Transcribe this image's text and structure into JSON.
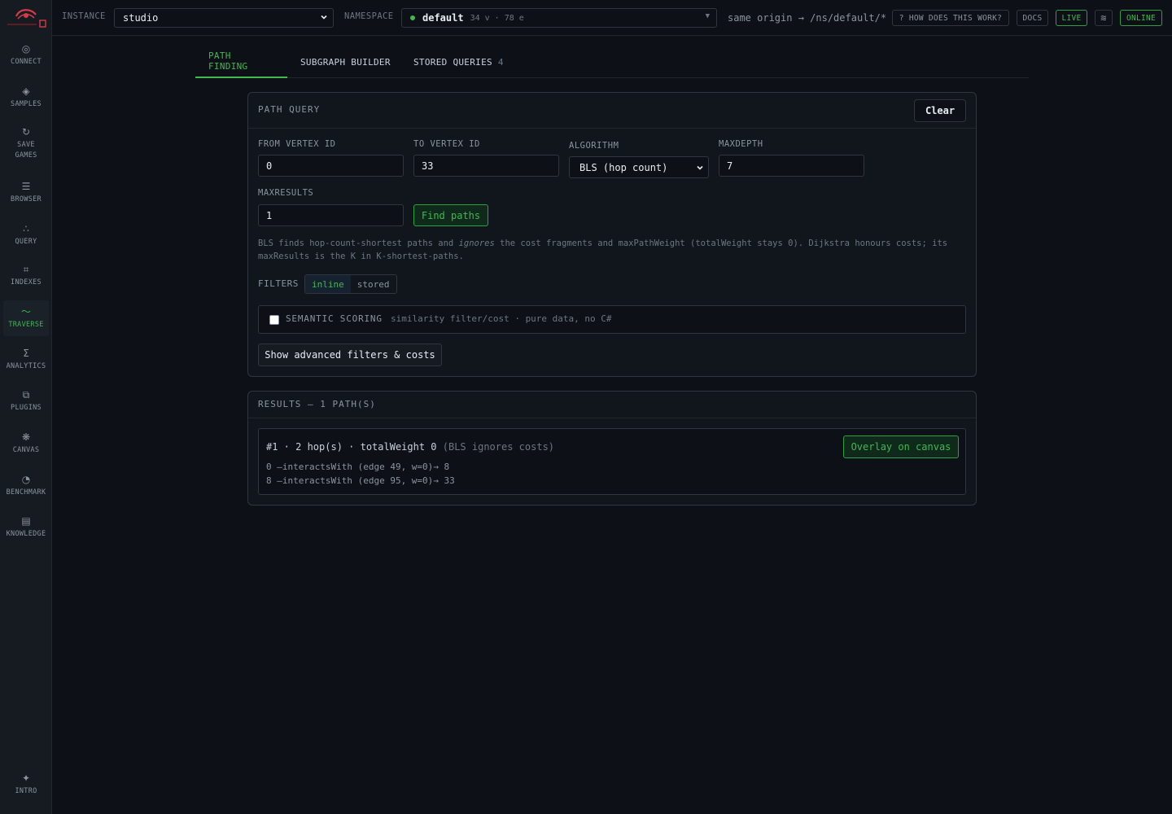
{
  "sidebar": {
    "items": [
      {
        "icon": "◎",
        "label": "CONNECT",
        "name": "sidebar-item-connect",
        "icon_name": "connect-icon"
      },
      {
        "icon": "◈",
        "label": "SAMPLES",
        "name": "sidebar-item-samples",
        "icon_name": "samples-icon"
      },
      {
        "icon": "↻",
        "label": "SAVE GAMES",
        "name": "sidebar-item-save-games",
        "icon_name": "refresh-icon"
      },
      {
        "icon": "☰",
        "label": "BROWSER",
        "name": "sidebar-item-browser",
        "icon_name": "list-icon"
      },
      {
        "icon": "∴",
        "label": "QUERY",
        "name": "sidebar-item-query",
        "icon_name": "query-icon"
      },
      {
        "icon": "⌗",
        "label": "INDEXES",
        "name": "sidebar-item-indexes",
        "icon_name": "index-icon"
      },
      {
        "icon": "〜",
        "label": "TRAVERSE",
        "name": "sidebar-item-traverse",
        "icon_name": "traverse-icon",
        "active": true
      },
      {
        "icon": "Σ",
        "label": "ANALYTICS",
        "name": "sidebar-item-analytics",
        "icon_name": "sigma-icon"
      },
      {
        "icon": "⧉",
        "label": "PLUGINS",
        "name": "sidebar-item-plugins",
        "icon_name": "plugins-icon"
      },
      {
        "icon": "❋",
        "label": "CANVAS",
        "name": "sidebar-item-canvas",
        "icon_name": "canvas-icon"
      },
      {
        "icon": "◔",
        "label": "BENCHMARK",
        "name": "sidebar-item-benchmark",
        "icon_name": "gauge-icon"
      },
      {
        "icon": "▤",
        "label": "KNOWLEDGE",
        "name": "sidebar-item-knowledge",
        "icon_name": "book-icon"
      }
    ],
    "intro": {
      "icon": "✦",
      "label": "INTRO"
    }
  },
  "topbar": {
    "instance_label": "INSTANCE",
    "instance_value": "studio",
    "namespace_label": "NAMESPACE",
    "namespace_name": "default",
    "namespace_stats": "34 v · 78 e",
    "namespace_caret": "▼",
    "origin": "same origin → /ns/default/*",
    "help": "? HOW DOES THIS WORK?",
    "docs": "DOCS",
    "live": "LIVE",
    "wave": "≋",
    "online": "ONLINE"
  },
  "tabs": [
    {
      "label": "PATH FINDING",
      "active": true
    },
    {
      "label": "SUBGRAPH BUILDER"
    },
    {
      "label": "STORED QUERIES",
      "count": "4"
    }
  ],
  "query": {
    "title": "PATH QUERY",
    "clear": "Clear",
    "from_label": "FROM VERTEX ID",
    "from_value": "0",
    "to_label": "TO VERTEX ID",
    "to_value": "33",
    "algo_label": "ALGORITHM",
    "algo_value": "BLS (hop count)",
    "maxdepth_label": "MAXDEPTH",
    "maxdepth_value": "7",
    "maxresults_label": "MAXRESULTS",
    "maxresults_value": "1",
    "find": "Find paths",
    "note_a": "BLS finds hop-count-shortest paths and ",
    "note_em": "ignores",
    "note_b": " the cost fragments and maxPathWeight (totalWeight stays 0). Dijkstra honours costs; its maxResults is the K in K-shortest-paths.",
    "filters_label": "FILTERS",
    "filter_inline": "inline",
    "filter_stored": "stored",
    "semantic_title": "SEMANTIC SCORING",
    "semantic_desc": "similarity filter/cost · pure data, no C#",
    "advanced": "Show advanced filters & costs"
  },
  "results": {
    "title": "RESULTS — 1 PATH(S)",
    "summary": "#1 · 2 hop(s) · totalWeight 0",
    "summary_note": "(BLS ignores costs)",
    "overlay": "Overlay on canvas",
    "hops": [
      "0 —interactsWith (edge 49, w=0)→ 8",
      "8 —interactsWith (edge 95, w=0)→ 33"
    ]
  },
  "colors": {
    "accent": "#3fb950",
    "background": "#0d1117",
    "panel": "#11161d",
    "border": "#30363d"
  }
}
